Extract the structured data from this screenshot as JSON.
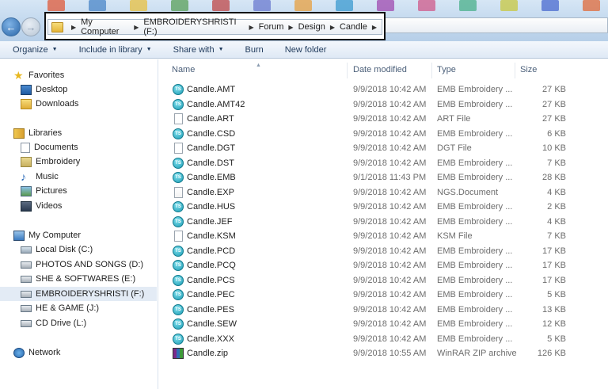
{
  "address": {
    "path": [
      "My Computer",
      "EMBROIDERYSHRISTI (F:)",
      "Forum",
      "Design",
      "Candle"
    ]
  },
  "toolbar": {
    "organize": "Organize",
    "include_in_library": "Include in library",
    "share_with": "Share with",
    "burn": "Burn",
    "new_folder": "New folder"
  },
  "sidebar": {
    "favorites": "Favorites",
    "desktop": "Desktop",
    "downloads": "Downloads",
    "libraries": "Libraries",
    "documents": "Documents",
    "embroidery": "Embroidery",
    "music": "Music",
    "pictures": "Pictures",
    "videos": "Videos",
    "my_computer": "My Computer",
    "drives": [
      "Local Disk (C:)",
      "PHOTOS AND SONGS (D:)",
      "SHE & SOFTWARES (E:)",
      "EMBROIDERYSHRISTI (F:)",
      "HE & GAME (J:)",
      "CD Drive (L:)"
    ],
    "network": "Network"
  },
  "columns": {
    "name": "Name",
    "date": "Date modified",
    "type": "Type",
    "size": "Size"
  },
  "files": [
    {
      "name": "Candle.AMT",
      "date": "9/9/2018 10:42 AM",
      "type": "EMB Embroidery ...",
      "size": "27 KB",
      "icon": "ts"
    },
    {
      "name": "Candle.AMT42",
      "date": "9/9/2018 10:42 AM",
      "type": "EMB Embroidery ...",
      "size": "27 KB",
      "icon": "ts"
    },
    {
      "name": "Candle.ART",
      "date": "9/9/2018 10:42 AM",
      "type": "ART File",
      "size": "27 KB",
      "icon": "doc"
    },
    {
      "name": "Candle.CSD",
      "date": "9/9/2018 10:42 AM",
      "type": "EMB Embroidery ...",
      "size": "6 KB",
      "icon": "ts"
    },
    {
      "name": "Candle.DGT",
      "date": "9/9/2018 10:42 AM",
      "type": "DGT File",
      "size": "10 KB",
      "icon": "doc"
    },
    {
      "name": "Candle.DST",
      "date": "9/9/2018 10:42 AM",
      "type": "EMB Embroidery ...",
      "size": "7 KB",
      "icon": "ts"
    },
    {
      "name": "Candle.EMB",
      "date": "9/1/2018 11:43 PM",
      "type": "EMB Embroidery ...",
      "size": "28 KB",
      "icon": "ts"
    },
    {
      "name": "Candle.EXP",
      "date": "9/9/2018 10:42 AM",
      "type": "NGS.Document",
      "size": "4 KB",
      "icon": "exp"
    },
    {
      "name": "Candle.HUS",
      "date": "9/9/2018 10:42 AM",
      "type": "EMB Embroidery ...",
      "size": "2 KB",
      "icon": "ts"
    },
    {
      "name": "Candle.JEF",
      "date": "9/9/2018 10:42 AM",
      "type": "EMB Embroidery ...",
      "size": "4 KB",
      "icon": "ts"
    },
    {
      "name": "Candle.KSM",
      "date": "9/9/2018 10:42 AM",
      "type": "KSM File",
      "size": "7 KB",
      "icon": "doc"
    },
    {
      "name": "Candle.PCD",
      "date": "9/9/2018 10:42 AM",
      "type": "EMB Embroidery ...",
      "size": "17 KB",
      "icon": "ts"
    },
    {
      "name": "Candle.PCQ",
      "date": "9/9/2018 10:42 AM",
      "type": "EMB Embroidery ...",
      "size": "17 KB",
      "icon": "ts"
    },
    {
      "name": "Candle.PCS",
      "date": "9/9/2018 10:42 AM",
      "type": "EMB Embroidery ...",
      "size": "17 KB",
      "icon": "ts"
    },
    {
      "name": "Candle.PEC",
      "date": "9/9/2018 10:42 AM",
      "type": "EMB Embroidery ...",
      "size": "5 KB",
      "icon": "ts"
    },
    {
      "name": "Candle.PES",
      "date": "9/9/2018 10:42 AM",
      "type": "EMB Embroidery ...",
      "size": "13 KB",
      "icon": "ts"
    },
    {
      "name": "Candle.SEW",
      "date": "9/9/2018 10:42 AM",
      "type": "EMB Embroidery ...",
      "size": "12 KB",
      "icon": "ts"
    },
    {
      "name": "Candle.XXX",
      "date": "9/9/2018 10:42 AM",
      "type": "EMB Embroidery ...",
      "size": "5 KB",
      "icon": "ts"
    },
    {
      "name": "Candle.zip",
      "date": "9/9/2018 10:55 AM",
      "type": "WinRAR ZIP archive",
      "size": "126 KB",
      "icon": "zip"
    }
  ],
  "colors": {
    "toolbar_text": "#1e395b",
    "header_text": "#4c607a",
    "meta_text": "#6d6d6d",
    "selected_row": "#e3ebf5"
  }
}
